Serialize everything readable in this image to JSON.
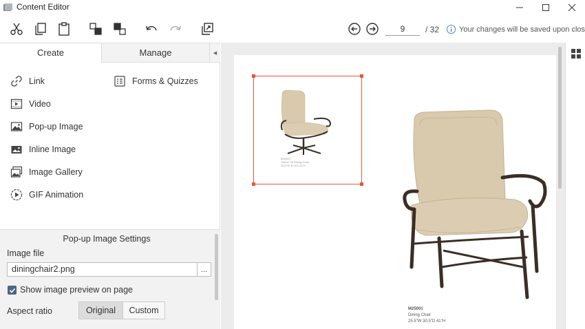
{
  "window": {
    "title": "Content Editor"
  },
  "toolbar": {
    "buttons": [
      "cut",
      "copy",
      "paste",
      "bring-forward",
      "send-backward",
      "undo",
      "redo",
      "export"
    ],
    "page_current": "9",
    "page_total": "/ 32",
    "save_notice": "Your changes will be saved upon close"
  },
  "tabs": {
    "create": "Create",
    "manage": "Manage"
  },
  "create_items": {
    "link": "Link",
    "forms": "Forms & Quizzes",
    "video": "Video",
    "popup_image": "Pop-up Image",
    "inline_image": "Inline Image",
    "image_gallery": "Image Gallery",
    "gif_animation": "GIF Animation"
  },
  "settings": {
    "title": "Pop-up Image Settings",
    "image_file_label": "Image file",
    "image_file_value": "diningchair2.png",
    "browse_label": "...",
    "show_preview_label": "Show image preview on page",
    "show_preview_checked": true,
    "aspect_ratio_label": "Aspect ratio",
    "aspect_options": [
      "Original",
      "Custom"
    ],
    "aspect_selected": "Original"
  },
  "page_content": {
    "small_caption": [
      "M25001",
      "Swivel Tilt Dining Chair",
      "25.5\"W  30.5\"D  41\"H"
    ],
    "big_caption": [
      "M25001",
      "Dining Chair",
      "25.5\"W  30.5\"D  41\"H"
    ]
  },
  "colors": {
    "selection": "#e05a3a",
    "cushion": "#d9c9ad",
    "frame": "#3a2e26",
    "checkbox": "#4a6785"
  }
}
